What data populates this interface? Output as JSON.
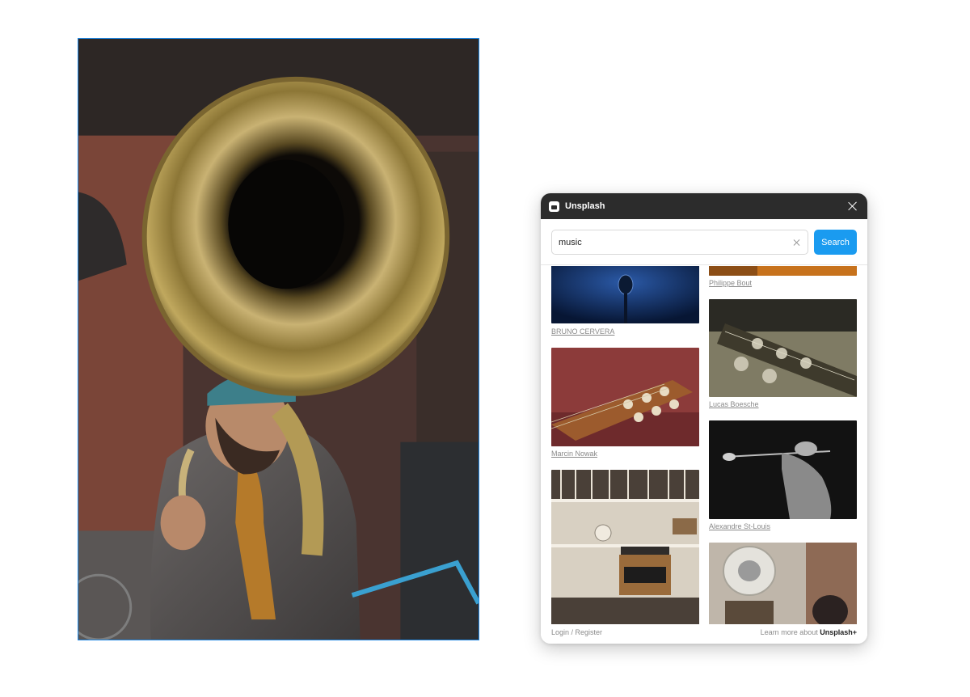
{
  "canvas": {
    "image_description": "sousaphone-player-photo"
  },
  "panel": {
    "title": "Unsplash",
    "search": {
      "value": "music",
      "button_label": "Search"
    },
    "results": [
      {
        "credit": "BRUNO CERVERA",
        "subject": "microphone-photo"
      },
      {
        "credit": "Philippe Bout",
        "subject": "orange-photo"
      },
      {
        "credit": "Marcin Nowak",
        "subject": "guitar-headstock-photo"
      },
      {
        "credit": "Lucas Boesche",
        "subject": "guitar-tuners-photo"
      },
      {
        "credit": "Alexandre St-Louis",
        "subject": "guitarist-bw-photo"
      },
      {
        "credit": "",
        "subject": "record-shelf-photo"
      },
      {
        "credit": "",
        "subject": "sousaphone-street-photo"
      }
    ],
    "footer": {
      "login": "Login / Register",
      "learn_prefix": "Learn more about",
      "learn_brand": "Unsplash+"
    }
  },
  "colors": {
    "accent": "#1a9bf0",
    "titlebar": "#2c2c2c",
    "selection": "#1e88e5"
  }
}
